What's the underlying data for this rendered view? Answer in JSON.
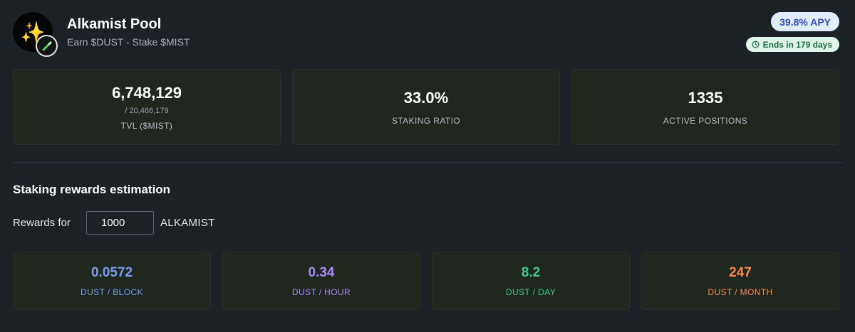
{
  "pool": {
    "logo_icon": "sparkles-icon",
    "badge_icon": "wand-icon",
    "title": "Alkamist Pool",
    "subtitle": "Earn $DUST - Stake $MIST",
    "apy": "39.8% APY",
    "ends": "Ends in 179 days"
  },
  "stats": {
    "tvl_value": "6,748,129",
    "tvl_total": "/ 20,466,179",
    "tvl_label": "TVL ($MIST)",
    "ratio_value": "33.0%",
    "ratio_label": "STAKING RATIO",
    "positions_value": "1335",
    "positions_label": "ACTIVE POSITIONS"
  },
  "estimation": {
    "title": "Staking rewards estimation",
    "rewards_for_label": "Rewards for",
    "amount": "1000",
    "token": "ALKAMIST"
  },
  "rewards": [
    {
      "value": "0.0572",
      "unit": "DUST / BLOCK",
      "color": "#7b9cf4"
    },
    {
      "value": "0.34",
      "unit": "DUST / HOUR",
      "color": "#a98af5"
    },
    {
      "value": "8.2",
      "unit": "DUST / DAY",
      "color": "#3ec98a"
    },
    {
      "value": "247",
      "unit": "DUST / MONTH",
      "color": "#f7894a"
    }
  ],
  "colors": {
    "background": "#1c2126",
    "card": "#20271f",
    "apy_pill_bg": "#e2ecff",
    "apy_text": "#2d4fc4",
    "ends_pill_bg": "#dff4e8",
    "ends_text": "#1f6b43"
  }
}
